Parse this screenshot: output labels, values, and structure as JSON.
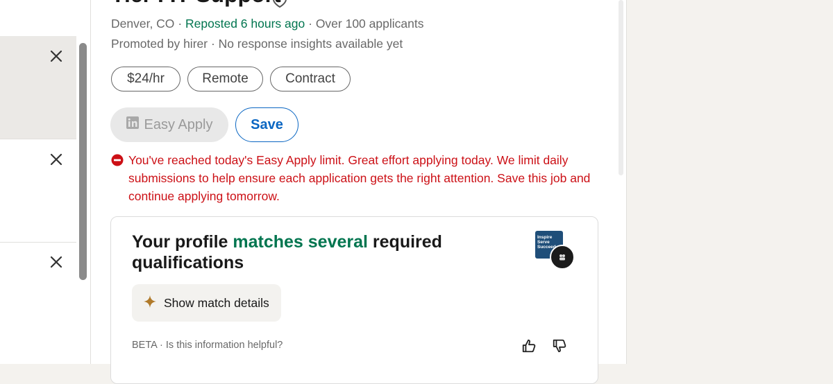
{
  "left_list": {
    "items": [
      {
        "close_label": "Dismiss"
      },
      {
        "close_label": "Dismiss"
      },
      {
        "close_label": "Dismiss"
      }
    ]
  },
  "job": {
    "title": "Tier I IT Support",
    "location": "Denver, CO",
    "separator": "·",
    "reposted": "Reposted 6 hours ago",
    "applicants": "Over 100 applicants",
    "promoted": "Promoted by hirer",
    "insights": "No response insights available yet",
    "pills": [
      "$24/hr",
      "Remote",
      "Contract"
    ],
    "easy_apply_label": "Easy Apply",
    "save_label": "Save",
    "limit_message": "You've reached today's Easy Apply limit. Great effort applying today. We limit daily submissions to help ensure each application gets the right attention. Save this job and continue applying tomorrow."
  },
  "match_card": {
    "title_prefix": "Your profile ",
    "title_highlight": "matches several",
    "title_suffix": " required qualifications",
    "logo_text": "Inspire Serve Succeed",
    "show_button": "Show match details",
    "beta": "BETA",
    "separator": "·",
    "helpful_question": "Is this information helpful?"
  },
  "colors": {
    "green": "#01754f",
    "error_red": "#cc1016",
    "link_blue": "#0a66c2",
    "sparkle": "#b07a2a"
  },
  "icons": [
    "close-icon",
    "linkedin-icon",
    "error-icon",
    "sparkle-icon",
    "thumbs-up-icon",
    "thumbs-down-icon"
  ]
}
